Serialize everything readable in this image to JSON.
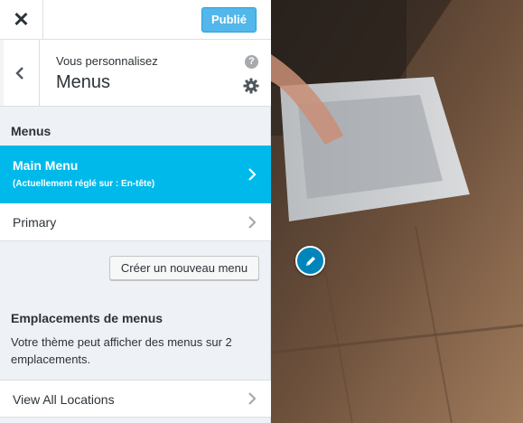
{
  "header": {
    "close_icon": "close-icon",
    "publish_label": "Publié"
  },
  "info": {
    "subtitle": "Vous personnalisez",
    "title": "Menus",
    "help_glyph": "?"
  },
  "menus_section": {
    "title": "Menus",
    "items": [
      {
        "name": "Main Menu",
        "note": "(Actuellement réglé sur : En-tête)",
        "active": true
      },
      {
        "name": "Primary",
        "note": "",
        "active": false
      }
    ],
    "create_label": "Créer un nouveau menu"
  },
  "locations_section": {
    "title": "Emplacements de menus",
    "description": "Votre thème peut afficher des menus sur 2 emplacements.",
    "view_all_label": "View All Locations"
  },
  "colors": {
    "active_item": "#00b9eb",
    "publish_button": "#52b7ea",
    "edit_shortcut": "#0085ba"
  }
}
